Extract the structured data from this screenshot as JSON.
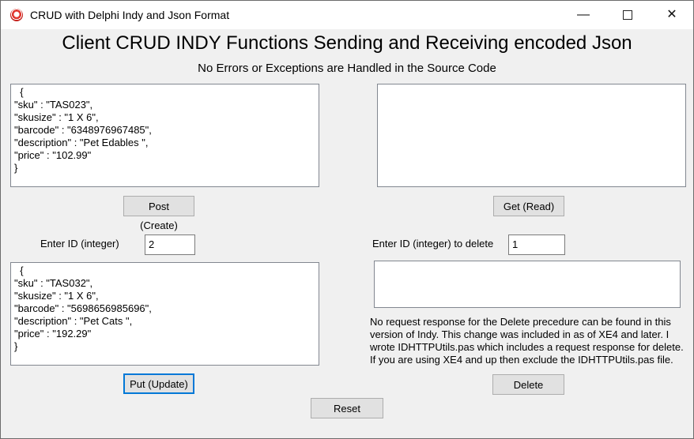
{
  "window": {
    "title": "CRUD with Delphi Indy and Json Format",
    "minimize_glyph": "—",
    "close_glyph": "✕"
  },
  "header": {
    "title": "Client CRUD INDY Functions Sending and Receiving encoded Json",
    "subtitle": "No Errors or Exceptions are Handled in the Source Code"
  },
  "post": {
    "memo_text": "  {\n\"sku\" : \"TAS023\",\n\"skusize\" : \"1 X 6\",\n\"barcode\" : \"6348976967485\",\n\"description\" : \"Pet Edables \",\n\"price\" : \"102.99\"\n}",
    "button_label": "Post (Create)"
  },
  "get": {
    "memo_text": "",
    "button_label": "Get (Read)"
  },
  "put": {
    "id_label": "Enter ID (integer)",
    "id_value": "2",
    "memo_text": "  {\n\"sku\" : \"TAS032\",\n\"skusize\" : \"1 X 6\",\n\"barcode\" : \"5698656985696\",\n\"description\" : \"Pet Cats \",\n\"price\" : \"192.29\"\n}",
    "button_label": "Put (Update)"
  },
  "delete": {
    "id_label": "Enter ID (integer) to delete",
    "id_value": "1",
    "memo_text": "",
    "note": "No request response for the Delete precedure can be found in this version of Indy.  This change was  included in  as of XE4 and later. I wrote IDHTTPUtils.pas which includes a request response for delete. If you are using XE4 and up then exclude the IDHTTPUtils.pas file.",
    "button_label": "Delete"
  },
  "reset": {
    "button_label": "Reset"
  }
}
